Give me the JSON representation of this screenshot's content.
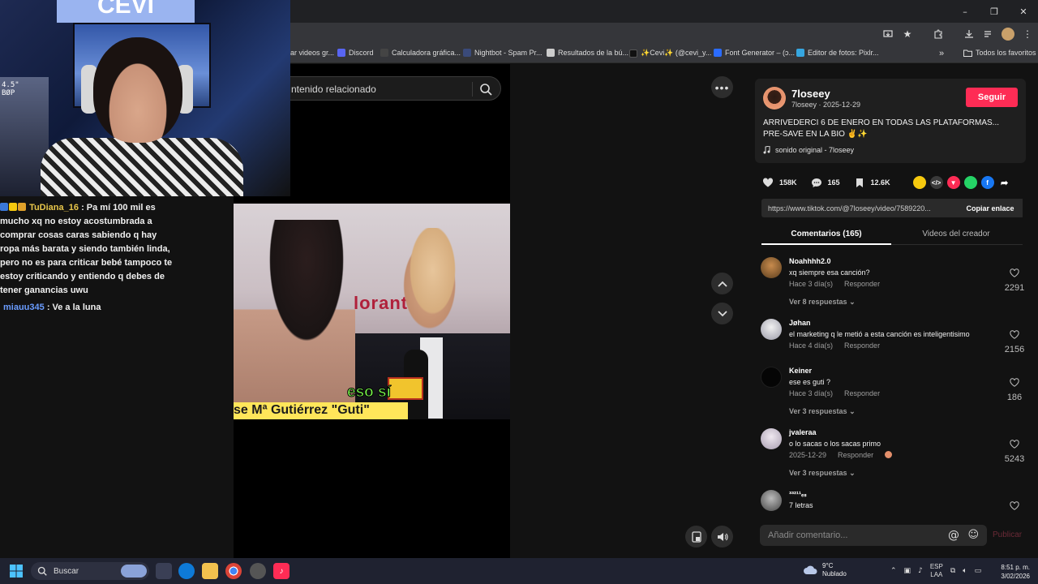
{
  "window": {
    "minimize": "–",
    "restore": "❐",
    "close": "✕"
  },
  "bookmarks": [
    {
      "label": "ar videos gr...",
      "color": "#777777"
    },
    {
      "label": "Discord",
      "color": "#5865f2"
    },
    {
      "label": "Calculadora gráfica...",
      "color": "#444444"
    },
    {
      "label": "Nightbot - Spam Pr...",
      "color": "#3a4a7a"
    },
    {
      "label": "Resultados de la bú...",
      "color": "#cccccc"
    },
    {
      "label": "✨Cevi✨ (@cevi_y...",
      "color": "#111111"
    },
    {
      "label": "Font Generator – (ↄ...",
      "color": "#2b6cff"
    },
    {
      "label": "Editor de fotos: Pixlr...",
      "color": "#36a6e0"
    }
  ],
  "bookmarks_more": "»",
  "all_favorites": "Todos los favoritos",
  "search": {
    "text": "ntenido relacionado"
  },
  "video": {
    "caption_top": "eso sí",
    "caption_bottom": "se Mª Gutiérrez \"Guti\"",
    "logo": "lorant"
  },
  "webcam": {
    "sign": "CEVI",
    "label": "4.5\"\nBØP"
  },
  "chat": [
    {
      "user": "TuDiana_16",
      "text": ": Pa mí 100 mil es mucho xq no estoy acostumbrada a comprar cosas caras sabiendo q hay ropa más barata y siendo también linda, pero no es para criticar bebé tampoco te estoy criticando y entiendo q debes de tener ganancias uwu"
    },
    {
      "user": "miauu345",
      "text": ": Ve a la luna"
    }
  ],
  "creator": {
    "name": "7loseey",
    "meta": "7loseey · 2025-12-29",
    "follow": "Seguir",
    "caption": "ARRIVEDERCI 6 DE ENERO EN TODAS LAS PLATAFORMAS... PRE-SAVE EN LA BIO ✌️✨",
    "sound": "sonido original - 7loseey"
  },
  "actions": {
    "likes": "158K",
    "comments": "165",
    "saves": "12.6K"
  },
  "share_colors": [
    "#f6c90e",
    "#3a3a3a",
    "#fe2c55",
    "#25d366",
    "#1877f2"
  ],
  "link": {
    "url": "https://www.tiktok.com/@7loseey/video/7589220...",
    "copy": "Copiar enlace"
  },
  "tabs": {
    "comments": "Comentarios (165)",
    "videos": "Videos del creador"
  },
  "comments": [
    {
      "name": "Noahhhh2.0",
      "text": "xq siempre esa canción?",
      "time": "Hace 3 día(s)",
      "reply": "Responder",
      "likes": "2291",
      "replies": "Ver 8 respuestas",
      "avatar": "#7a5a2e"
    },
    {
      "name": "Jøhan",
      "text": "el marketing q le metió a esta canción es inteligentisimo",
      "time": "Hace 4 día(s)",
      "reply": "Responder",
      "likes": "2156",
      "replies": "",
      "avatar": "#b9b9c9"
    },
    {
      "name": "Keiner",
      "text": "ese es guti ?",
      "time": "Hace 3 día(s)",
      "reply": "Responder",
      "likes": "186",
      "replies": "Ver 3 respuestas",
      "avatar": "#050505"
    },
    {
      "name": "jvaleraa",
      "text": "o lo sacas o los sacas primo",
      "time": "2025-12-29",
      "reply": "Responder",
      "likes": "5243",
      "replies": "Ver 3 respuestas",
      "avatar": "#c9c0cf"
    },
    {
      "name": "³³²¹¹ₑₛ",
      "text": "7 letras",
      "time": "",
      "reply": "",
      "likes": "",
      "replies": "",
      "avatar": "#8a8a8a"
    }
  ],
  "add_comment": {
    "placeholder": "Añadir comentario...",
    "at": "@",
    "emoji": "☺",
    "publish": "Publicar"
  },
  "taskbar": {
    "search": "Buscar",
    "weather_temp": "9°C",
    "weather_desc": "Nublado",
    "lang1": "ESP",
    "lang2": "LAA",
    "time": "8:51 p. m.",
    "date": "3/02/2026"
  }
}
